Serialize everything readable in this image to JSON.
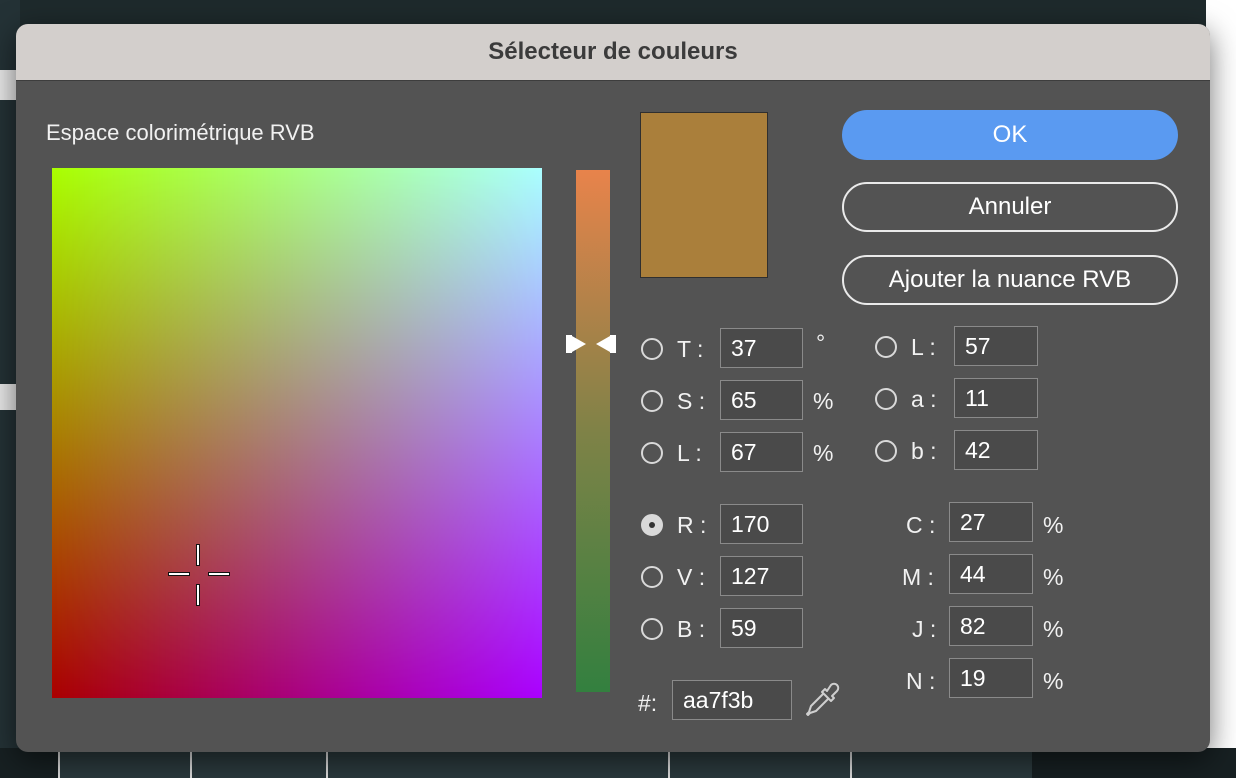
{
  "dialog": {
    "title": "Sélecteur de couleurs",
    "color_space_label": "Espace colorimétrique RVB",
    "current_color": "#aa7f3b",
    "accent_color": "#5a9af1"
  },
  "buttons": {
    "ok": "OK",
    "cancel": "Annuler",
    "add_swatch": "Ajouter la nuance RVB"
  },
  "hsl": {
    "t": {
      "label": "T :",
      "value": "37",
      "unit": "°"
    },
    "s": {
      "label": "S :",
      "value": "65",
      "unit": "%"
    },
    "l": {
      "label": "L :",
      "value": "67",
      "unit": "%"
    }
  },
  "lab": {
    "l": {
      "label": "L :",
      "value": "57"
    },
    "a": {
      "label": "a :",
      "value": "11"
    },
    "b": {
      "label": "b :",
      "value": "42"
    }
  },
  "rgb": {
    "r": {
      "label": "R :",
      "value": "170",
      "selected": true
    },
    "v": {
      "label": "V :",
      "value": "127"
    },
    "b": {
      "label": "B :",
      "value": "59"
    }
  },
  "cmyk": {
    "c": {
      "label": "C :",
      "value": "27",
      "unit": "%"
    },
    "m": {
      "label": "M :",
      "value": "44",
      "unit": "%"
    },
    "j": {
      "label": "J :",
      "value": "82",
      "unit": "%"
    },
    "n": {
      "label": "N :",
      "value": "19",
      "unit": "%"
    }
  },
  "hex": {
    "label": "#:",
    "value": "aa7f3b"
  },
  "icons": {
    "eyedropper": "eyedropper-icon"
  }
}
